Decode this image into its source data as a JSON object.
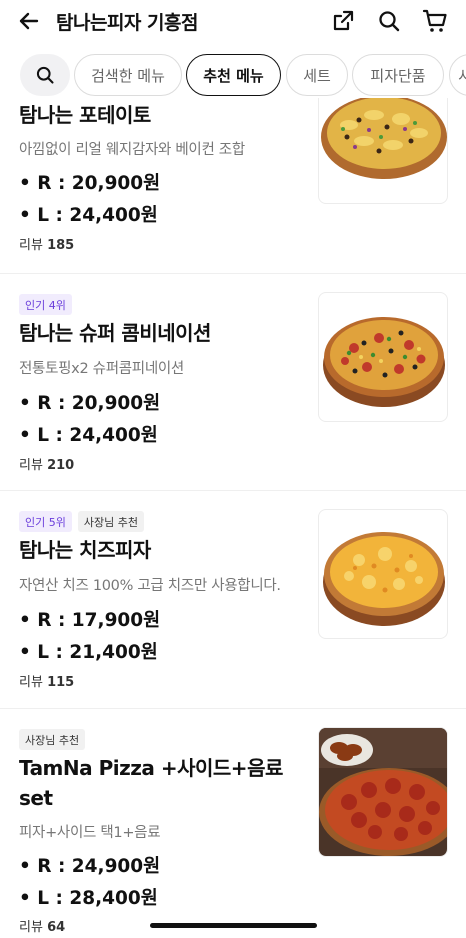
{
  "header": {
    "title": "탐나는피자 기흥점"
  },
  "tabs": [
    {
      "label": "검색한 메뉴",
      "active": false
    },
    {
      "label": "추천 메뉴",
      "active": true
    },
    {
      "label": "세트",
      "active": false
    },
    {
      "label": "피자단품",
      "active": false
    },
    {
      "label": "사이드",
      "active": false
    }
  ],
  "menu_items": [
    {
      "name": "탐나는 포테이토",
      "description": "아낌없이 리얼 웨지감자와 베이컨 조합",
      "price_r": "• R : 20,900원",
      "price_l": "• L : 24,400원",
      "review_label": "리뷰",
      "review_count": "185",
      "image": "potato-pizza"
    },
    {
      "badges": [
        "인기 4위"
      ],
      "name": "탐나는 슈퍼 콤비네이션",
      "description": "전통토핑x2 슈퍼콤피네이션",
      "price_r": "• R : 20,900원",
      "price_l": "• L : 24,400원",
      "review_label": "리뷰",
      "review_count": "210",
      "image": "super-combination-pizza"
    },
    {
      "badges": [
        "인기 5위",
        "사장님 추천"
      ],
      "name": "탐나는 치즈피자",
      "description": "자연산 치즈 100%  고급 치즈만 사용합니다.",
      "price_r": "• R : 17,900원",
      "price_l": "• L : 21,400원",
      "review_label": "리뷰",
      "review_count": "115",
      "image": "cheese-pizza"
    },
    {
      "badges": [
        "사장님 추천"
      ],
      "name": "TamNa Pizza +사이드+음료 set",
      "description": "피자+사이드 택1+음료",
      "price_r": "• R : 24,900원",
      "price_l": "• L : 28,400원",
      "review_label": "리뷰",
      "review_count": "64",
      "image": "pepperoni-pizza-with-wings"
    }
  ],
  "colors": {
    "rank_badge_bg": "#f1ecfd",
    "rank_badge_text": "#6a3ddb",
    "owner_badge_bg": "#f1f1f1"
  }
}
